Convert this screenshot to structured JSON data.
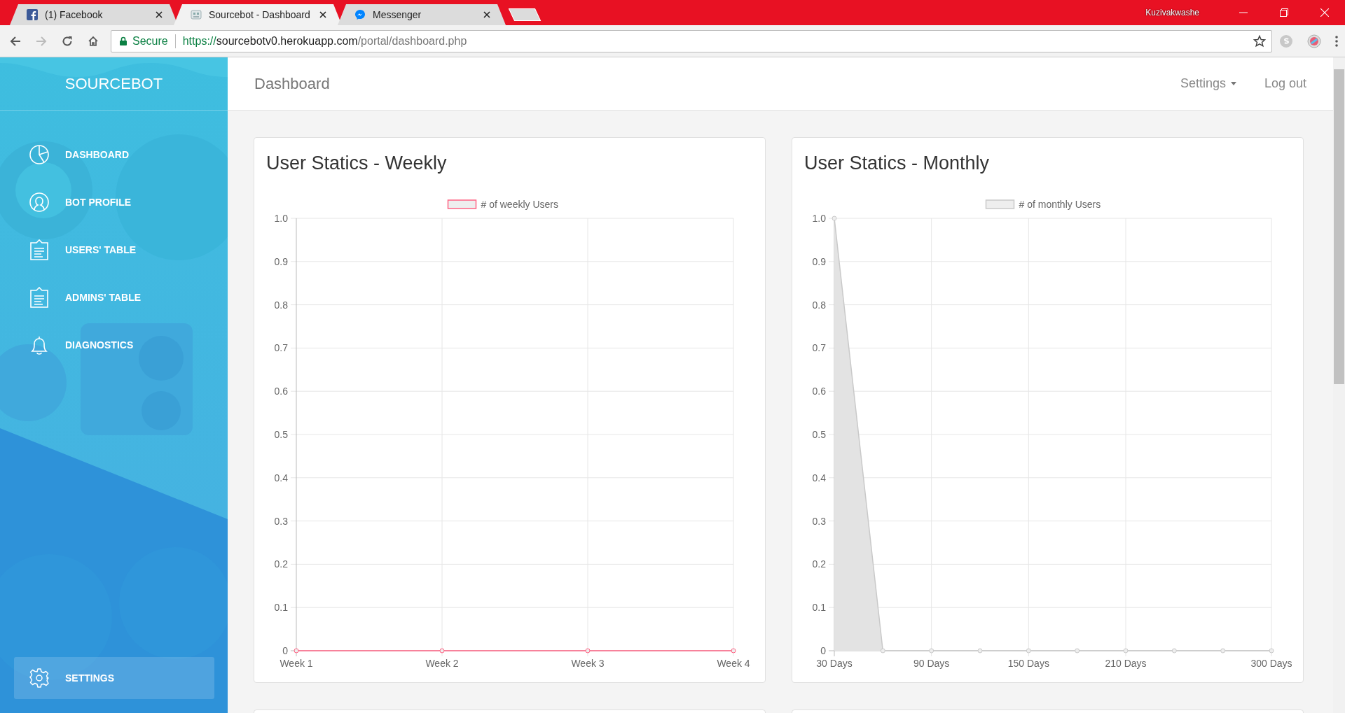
{
  "browser": {
    "tabs": [
      {
        "title": "(1) Facebook",
        "kind": "facebook",
        "selected": false
      },
      {
        "title": "Sourcebot - Dashboard",
        "kind": "robot",
        "selected": true
      },
      {
        "title": "Messenger",
        "kind": "messenger",
        "selected": false
      }
    ],
    "user": "Kuzivakwashe",
    "address": {
      "secure_label": "Secure",
      "scheme": "https://",
      "host": "sourcebotv0.herokuapp.com",
      "path": "/portal/dashboard.php"
    }
  },
  "sidebar": {
    "logo": "SOURCEBOT",
    "items": [
      {
        "label": "DASHBOARD",
        "kind": "pie"
      },
      {
        "label": "BOT PROFILE",
        "kind": "profile"
      },
      {
        "label": "USERS' TABLE",
        "kind": "clipboard"
      },
      {
        "label": "ADMINS' TABLE",
        "kind": "clipboard"
      },
      {
        "label": "DIAGNOSTICS",
        "kind": "bell"
      }
    ],
    "settings": {
      "label": "SETTINGS"
    }
  },
  "navbar": {
    "title": "Dashboard",
    "menu": [
      {
        "label": "Settings",
        "dropdown": true
      },
      {
        "label": "Log out",
        "dropdown": false
      }
    ]
  },
  "cards": [
    {
      "title": "User Statics - Weekly",
      "chart_data": {
        "type": "line",
        "categories": [
          "Week 1",
          "Week 2",
          "Week 3",
          "Week 4"
        ],
        "grid": true,
        "series": [
          {
            "name": "# of weekly Users",
            "color": "#ff6384",
            "marker": true,
            "values": [
              0,
              0,
              0,
              0
            ]
          }
        ],
        "ylim": [
          0,
          1
        ],
        "yticks": [
          0,
          0.1,
          0.2,
          0.3,
          0.4,
          0.5,
          0.6,
          0.7,
          0.8,
          0.9,
          {
            "value": 1,
            "label": "1.0"
          }
        ]
      }
    },
    {
      "title": "User Statics - Monthly",
      "chart_data": {
        "type": "area",
        "x": [
          30,
          60,
          90,
          120,
          150,
          180,
          210,
          240,
          270,
          300
        ],
        "grid": true,
        "series": [
          {
            "name": "# of monthly Users",
            "color": "#c9c9c9",
            "marker": true,
            "values": [
              1,
              0,
              0,
              0,
              0,
              0,
              0,
              0,
              0,
              0
            ]
          }
        ],
        "xlim": [
          30,
          300
        ],
        "xticks": [
          {
            "value": 30,
            "label": "30 Days"
          },
          {
            "value": 90,
            "label": "90 Days"
          },
          {
            "value": 150,
            "label": "150 Days"
          },
          {
            "value": 210,
            "label": "210 Days"
          },
          {
            "value": 300,
            "label": "300 Days"
          }
        ],
        "ylim": [
          0,
          1
        ],
        "yticks": [
          0,
          0.1,
          0.2,
          0.3,
          0.4,
          0.5,
          0.6,
          0.7,
          0.8,
          0.9,
          {
            "value": 1,
            "label": "1.0"
          }
        ]
      }
    }
  ]
}
